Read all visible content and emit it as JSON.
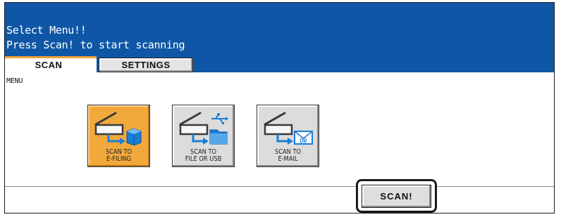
{
  "header": {
    "line1": "Select Menu!!",
    "line2": "Press Scan! to start scanning",
    "background": "#0f57a6"
  },
  "tabs": [
    {
      "label": "SCAN",
      "selected": true
    },
    {
      "label": "SETTINGS",
      "selected": false
    }
  ],
  "menu_label": "MENU",
  "functions": [
    {
      "line1": "SCAN TO",
      "line2": "E-FILING",
      "icon": "scanner-to-efiling-icon",
      "selected": true
    },
    {
      "line1": "SCAN TO",
      "line2": "FILE OR USB",
      "icon": "scanner-to-usb-folder-icon",
      "selected": false
    },
    {
      "line1": "SCAN TO",
      "line2": "E-MAIL",
      "icon": "scanner-to-email-icon",
      "selected": false
    }
  ],
  "scan_button": {
    "label": "SCAN!"
  },
  "colors": {
    "accent_tab": "#f2a430",
    "selected_button": "#f2a93c",
    "button_face": "#dcdcdc",
    "icon_blue": "#1a7ed6"
  }
}
